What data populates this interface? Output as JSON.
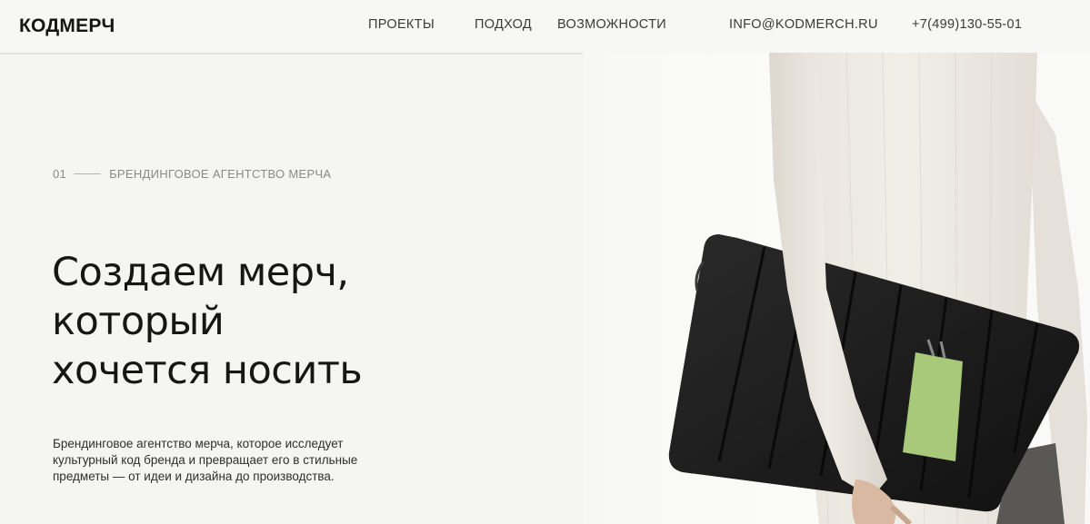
{
  "header": {
    "logo": "КОДМЕРЧ",
    "nav": [
      {
        "label": "ПРОЕКТЫ"
      },
      {
        "label": "ПОДХОД"
      },
      {
        "label": "ВОЗМОЖНОСТИ"
      }
    ],
    "email": "INFO@KODMERCH.RU",
    "phone": "+7(499)130-55-01"
  },
  "hero": {
    "eyebrow_number": "01",
    "eyebrow_text": "БРЕНДИНГОВОЕ АГЕНТСТВО МЕРЧА",
    "headline_lines": [
      "Создаем мерч,",
      "который",
      "хочется носить"
    ],
    "lead_lines": [
      "Брендинговое агентство мерча, которое исследует",
      "культурный код бренда и превращает его в стильные",
      "предметы — от идеи и дизайна до производства."
    ]
  },
  "colors": {
    "background": "#f5f5f3",
    "text": "#161616",
    "muted": "#8a8a88",
    "accent_card": "#a8c97a",
    "sleeve": "#1c1c1c",
    "sweater": "#ece9e3"
  }
}
